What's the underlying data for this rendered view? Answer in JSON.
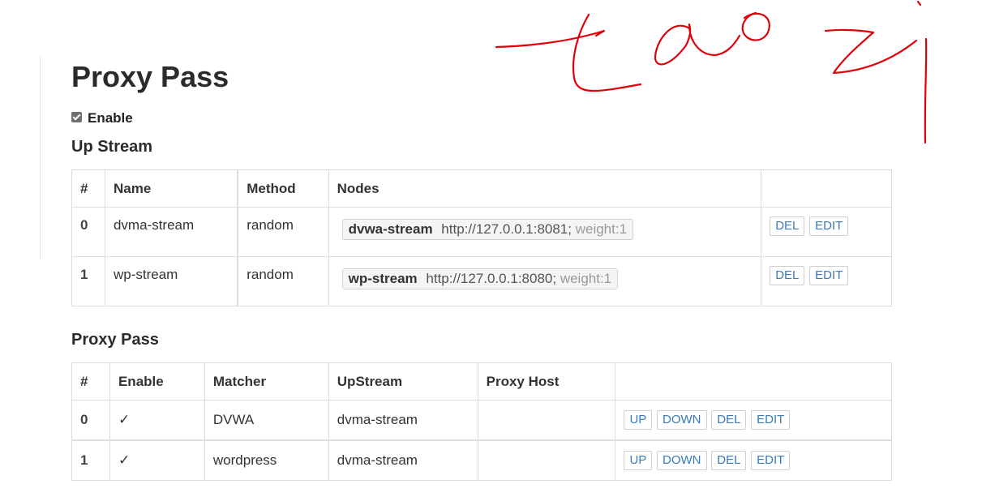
{
  "page": {
    "title": "Proxy Pass",
    "enable_label": "Enable",
    "enable_checked": true
  },
  "upstream": {
    "heading": "Up Stream",
    "columns": [
      "#",
      "Name",
      "Method",
      "Nodes",
      ""
    ],
    "rows": [
      {
        "index": "0",
        "name": "dvma-stream",
        "method": "random",
        "node_name": "dvwa-stream",
        "node_addr": "http://127.0.0.1:8081;",
        "node_weight": "weight:1",
        "del_label": "DEL",
        "edit_label": "EDIT"
      },
      {
        "index": "1",
        "name": "wp-stream",
        "method": "random",
        "node_name": "wp-stream",
        "node_addr": "http://127.0.0.1:8080;",
        "node_weight": "weight:1",
        "del_label": "DEL",
        "edit_label": "EDIT"
      }
    ]
  },
  "proxy_pass": {
    "heading": "Proxy Pass",
    "columns": [
      "#",
      "Enable",
      "Matcher",
      "UpStream",
      "Proxy Host",
      ""
    ],
    "rows": [
      {
        "index": "0",
        "enabled": "✓",
        "matcher": "DVWA",
        "upstream": "dvma-stream",
        "proxy_host": "",
        "up_label": "UP",
        "down_label": "DOWN",
        "del_label": "DEL",
        "edit_label": "EDIT"
      },
      {
        "index": "1",
        "enabled": "✓",
        "matcher": "wordpress",
        "upstream": "dvma-stream",
        "proxy_host": "",
        "up_label": "UP",
        "down_label": "DOWN",
        "del_label": "DEL",
        "edit_label": "EDIT"
      }
    ]
  },
  "colors": {
    "button_text": "#3a7ab8",
    "annotation": "#e0000a"
  },
  "annotation": {
    "type": "handwritten scribble",
    "text": "tao zi"
  }
}
